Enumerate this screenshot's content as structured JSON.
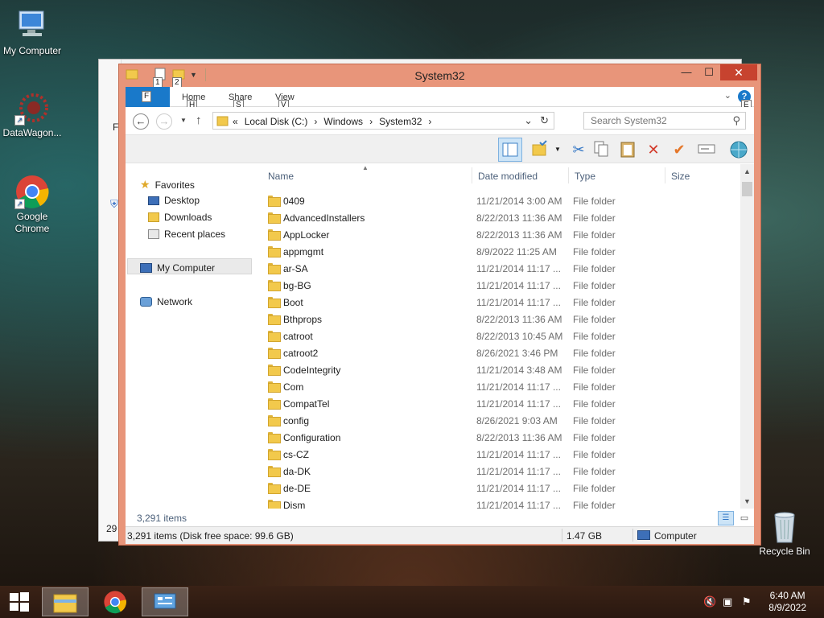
{
  "desktop": {
    "icons": [
      {
        "label": "My Computer"
      },
      {
        "label": "DataWagon..."
      },
      {
        "label": "Google Chrome"
      },
      {
        "label": "Recycle Bin"
      }
    ]
  },
  "background_window": {
    "status_fragment": "29",
    "nav_fragment": "F"
  },
  "window": {
    "title": "System32",
    "qat_keytips": [
      "1",
      "2"
    ],
    "controls": {
      "minimize": "—",
      "maximize": "☐",
      "close": "✕"
    },
    "accent_color": "#e8957a"
  },
  "ribbon": {
    "file_keytip": "F",
    "tabs": [
      {
        "label": "Home",
        "keytip": "H"
      },
      {
        "label": "Share",
        "keytip": "S"
      },
      {
        "label": "View",
        "keytip": "V"
      }
    ],
    "help_keytip": "E",
    "help_glyph": "?"
  },
  "address": {
    "overflow": "«",
    "crumbs": [
      "Local Disk (C:)",
      "Windows",
      "System32"
    ],
    "separator": "›",
    "search_placeholder": "Search System32"
  },
  "nav_pane": {
    "favorites": "Favorites",
    "favorite_items": [
      "Desktop",
      "Downloads",
      "Recent places"
    ],
    "computer": "My Computer",
    "network": "Network"
  },
  "columns": {
    "name": "Name",
    "date": "Date modified",
    "type": "Type",
    "size": "Size"
  },
  "files": [
    {
      "name": "0409",
      "date": "11/21/2014 3:00 AM",
      "type": "File folder"
    },
    {
      "name": "AdvancedInstallers",
      "date": "8/22/2013 11:36 AM",
      "type": "File folder"
    },
    {
      "name": "AppLocker",
      "date": "8/22/2013 11:36 AM",
      "type": "File folder"
    },
    {
      "name": "appmgmt",
      "date": "8/9/2022 11:25 AM",
      "type": "File folder"
    },
    {
      "name": "ar-SA",
      "date": "11/21/2014 11:17 ...",
      "type": "File folder"
    },
    {
      "name": "bg-BG",
      "date": "11/21/2014 11:17 ...",
      "type": "File folder"
    },
    {
      "name": "Boot",
      "date": "11/21/2014 11:17 ...",
      "type": "File folder"
    },
    {
      "name": "Bthprops",
      "date": "8/22/2013 11:36 AM",
      "type": "File folder"
    },
    {
      "name": "catroot",
      "date": "8/22/2013 10:45 AM",
      "type": "File folder"
    },
    {
      "name": "catroot2",
      "date": "8/26/2021 3:46 PM",
      "type": "File folder"
    },
    {
      "name": "CodeIntegrity",
      "date": "11/21/2014 3:48 AM",
      "type": "File folder"
    },
    {
      "name": "Com",
      "date": "11/21/2014 11:17 ...",
      "type": "File folder"
    },
    {
      "name": "CompatTel",
      "date": "11/21/2014 11:17 ...",
      "type": "File folder"
    },
    {
      "name": "config",
      "date": "8/26/2021 9:03 AM",
      "type": "File folder"
    },
    {
      "name": "Configuration",
      "date": "8/22/2013 11:36 AM",
      "type": "File folder"
    },
    {
      "name": "cs-CZ",
      "date": "11/21/2014 11:17 ...",
      "type": "File folder"
    },
    {
      "name": "da-DK",
      "date": "11/21/2014 11:17 ...",
      "type": "File folder"
    },
    {
      "name": "de-DE",
      "date": "11/21/2014 11:17 ...",
      "type": "File folder"
    },
    {
      "name": "Dism",
      "date": "11/21/2014 11:17 ...",
      "type": "File folder"
    }
  ],
  "status": {
    "item_count": "3,291 items",
    "detail": "3,291 items (Disk free space: 99.6 GB)",
    "size": "1.47 GB",
    "location": "Computer"
  },
  "taskbar": {
    "time": "6:40 AM",
    "date": "8/9/2022"
  }
}
